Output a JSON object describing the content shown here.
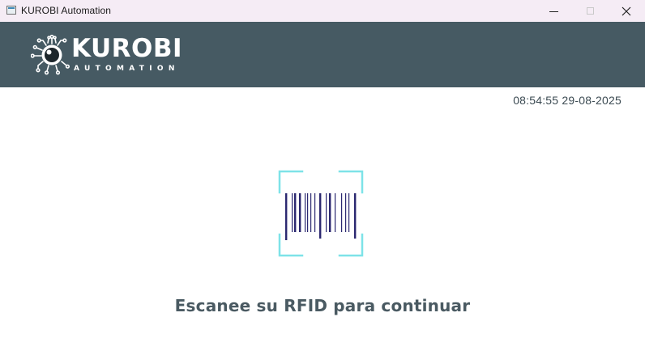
{
  "window": {
    "title": "KUROBI Automation",
    "controls": {
      "minimize": "minimize-icon",
      "maximize": "maximize-icon",
      "close": "close-icon"
    }
  },
  "header": {
    "brand_name": "KUROBI",
    "brand_tagline": "AUTOMATION",
    "logo_icon": "eye-circuit-icon",
    "background_color": "#465a63"
  },
  "main": {
    "clock": "08:54:55 29-08-2025",
    "scanner_icon": "barcode-scanner-icon",
    "prompt": "Escanee su RFID para continuar"
  },
  "colors": {
    "scanner_frame": "#7ee3e8",
    "barcode": "#2b2870",
    "prompt_text": "#4a5a62"
  }
}
